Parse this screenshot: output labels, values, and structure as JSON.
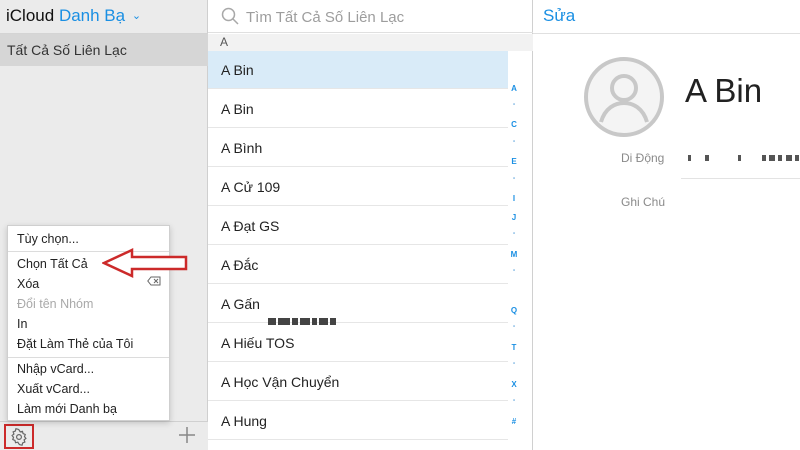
{
  "sidebar": {
    "app_name": "iCloud",
    "section_name": "Danh Bạ",
    "group_all": "Tất Cả Số Liên Lạc"
  },
  "menu": {
    "items": [
      {
        "label": "Tùy chọn...",
        "enabled": true
      },
      {
        "label": "Chọn Tất Cả",
        "enabled": true
      },
      {
        "label": "Xóa",
        "enabled": true
      },
      {
        "label": "Đổi tên Nhóm",
        "enabled": false
      },
      {
        "label": "In",
        "enabled": true
      },
      {
        "label": "Đặt Làm Thẻ của Tôi",
        "enabled": true
      },
      {
        "label": "Nhập vCard...",
        "enabled": true
      },
      {
        "label": "Xuất vCard...",
        "enabled": true
      },
      {
        "label": "Làm mới Danh bạ",
        "enabled": true
      }
    ]
  },
  "list": {
    "search_placeholder": "Tìm Tất Cả Số Liên Lạc",
    "section_header": "A",
    "contacts": [
      {
        "name": "A Bin",
        "selected": true
      },
      {
        "name": "A Bin"
      },
      {
        "name": "A Bình"
      },
      {
        "name": "A Cử 109"
      },
      {
        "name": "A Đạt GS"
      },
      {
        "name": "A Đắc"
      },
      {
        "name": "A Gấn",
        "redacted": true
      },
      {
        "name": "A Hiếu TOS"
      },
      {
        "name": "A Học Vận Chuyển"
      },
      {
        "name": "A Hung"
      }
    ],
    "index_letters": [
      "A",
      "•",
      "C",
      "•",
      "E",
      "•",
      "I",
      "J",
      "•",
      "M",
      "•",
      "Q",
      "•",
      "T",
      "•",
      "X",
      "•",
      "#"
    ]
  },
  "detail": {
    "edit_label": "Sửa",
    "name": "A Bin",
    "mobile_label": "Di Động",
    "note_label": "Ghi Chú"
  },
  "colors": {
    "accent": "#1a8fe3",
    "selected_row": "#d9ebf8",
    "annotation": "#cc2a2a"
  }
}
